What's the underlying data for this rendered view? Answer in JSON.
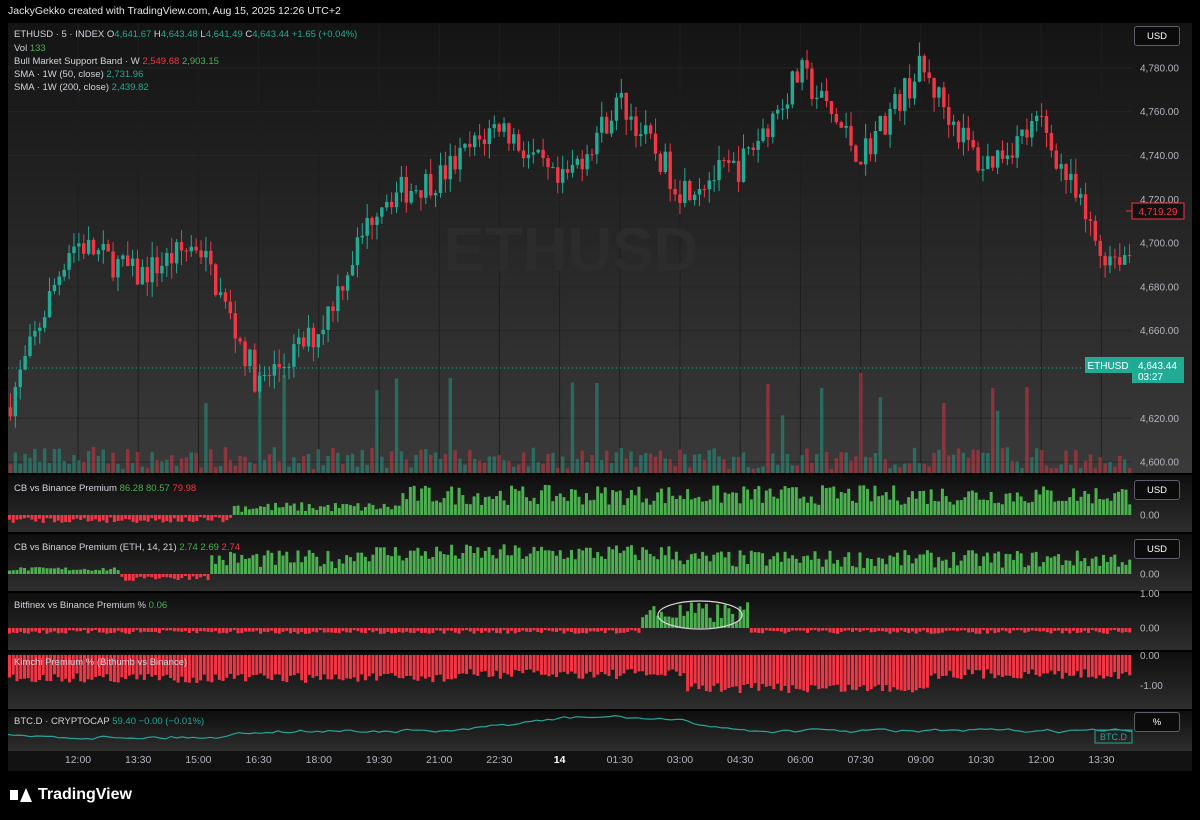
{
  "header": {
    "credit": "JackyGekko created with TradingView.com, Aug 15, 2025 12:26 UTC+2"
  },
  "main": {
    "symbol_line": {
      "symbol": "ETHUSD · 5 · INDEX",
      "o_label": "O",
      "o": "4,641.67",
      "h_label": "H",
      "h": "4,643.48",
      "l_label": "L",
      "l": "4,641.49",
      "c_label": "C",
      "c": "4,643.44",
      "chg": "+1.65 (+0.04%)"
    },
    "vol": {
      "label": "Vol",
      "value": "133"
    },
    "bull_band": {
      "label": "Bull Market Support Band · W",
      "v1": "2,549.68",
      "v2": "2,903.15"
    },
    "sma50": {
      "label": "SMA · 1W (50, close)",
      "value": "2,731.96"
    },
    "sma200": {
      "label": "SMA · 1W (200, close)",
      "value": "2,439.82"
    },
    "watermark": "ETHUSD",
    "currency_button": "USD",
    "price_labels": [
      "4,780.00",
      "4,760.00",
      "4,740.00",
      "4,720.00",
      "4,700.00",
      "4,680.00",
      "4,660.00",
      "4,620.00",
      "4,600.00"
    ],
    "marker_price": "4,719.29",
    "last_price_tag": {
      "symbol": "ETHUSD",
      "price": "4,643.44",
      "countdown": "03:27"
    }
  },
  "panes": [
    {
      "id": "cb",
      "legend": "CB vs Binance Premium",
      "values": [
        "86.28",
        "80.57",
        "79.98"
      ],
      "button": "USD",
      "axis": [
        "0.00"
      ]
    },
    {
      "id": "cb_eth",
      "legend": "CB vs Binance Premium (ETH, 14, 21)",
      "values": [
        "2.74",
        "2.69",
        "2.74"
      ],
      "button": "USD",
      "axis": [
        "0.00"
      ]
    },
    {
      "id": "bitfinex",
      "legend": "Bitfinex vs Binance Premium %",
      "values": [
        "0.06"
      ],
      "axis": [
        "1.00",
        "0.00"
      ]
    },
    {
      "id": "kimchi",
      "legend": "Kimchi Premium % (Bithumb vs Binance)",
      "values": [],
      "axis": [
        "0.00",
        "-1.00"
      ]
    },
    {
      "id": "btcd",
      "legend": "BTC.D · CRYPTOCAP",
      "values": [
        "59.40",
        "−0.00 (−0.01%)"
      ],
      "button": "%",
      "tag": "BTC.D"
    }
  ],
  "x_axis": [
    "12:00",
    "13:30",
    "15:00",
    "16:30",
    "18:00",
    "19:30",
    "21:00",
    "22:30",
    "14",
    "01:30",
    "03:00",
    "04:30",
    "06:00",
    "07:30",
    "09:00",
    "10:30",
    "12:00",
    "13:30"
  ],
  "brand": "TradingView",
  "colors": {
    "up": "#22ab94",
    "down": "#f23645",
    "hist_up": "#4caf50",
    "hist_down": "#f23645",
    "btcd": "#26a69a"
  },
  "chart_data": [
    {
      "type": "line",
      "title": "ETHUSD · 5 · INDEX",
      "series": [
        {
          "name": "ETHUSD",
          "x": [
            "12:00",
            "13:30",
            "15:00",
            "16:30",
            "18:00",
            "19:30",
            "21:00",
            "22:30",
            "14",
            "01:30",
            "03:00",
            "04:30",
            "06:00",
            "07:30",
            "09:00",
            "10:30",
            "12:00",
            "13:30"
          ],
          "values": [
            4700,
            4685,
            4700,
            4635,
            4660,
            4720,
            4730,
            4755,
            4725,
            4765,
            4725,
            4735,
            4778,
            4740,
            4780,
            4735,
            4755,
            4695
          ]
        }
      ],
      "ylim": [
        4595,
        4795
      ]
    },
    {
      "type": "bar",
      "title": "CB vs Binance Premium",
      "values_shown": [
        86.28,
        80.57,
        79.98
      ]
    },
    {
      "type": "bar",
      "title": "CB vs Binance Premium (ETH, 14, 21)",
      "values_shown": [
        2.74,
        2.69,
        2.74
      ]
    },
    {
      "type": "bar",
      "title": "Bitfinex vs Binance Premium %",
      "values_shown": [
        0.06
      ],
      "ylim": [
        -0.2,
        1.0
      ]
    },
    {
      "type": "bar",
      "title": "Kimchi Premium % (Bithumb vs Binance)",
      "ylim": [
        -1.5,
        0.1
      ]
    },
    {
      "type": "line",
      "title": "BTC.D · CRYPTOCAP",
      "values_shown": [
        59.4
      ]
    }
  ]
}
